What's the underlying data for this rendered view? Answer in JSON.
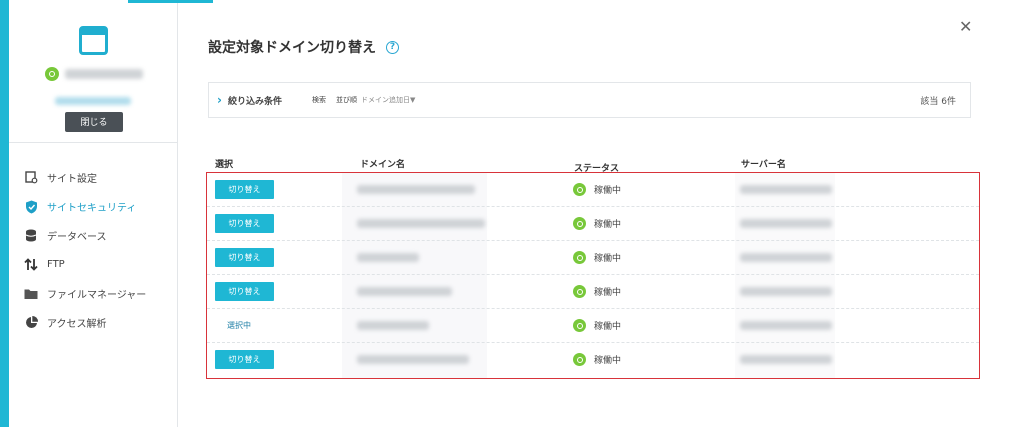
{
  "sidebar": {
    "close_label": "閉じる",
    "items": [
      {
        "label": "サイト設定",
        "icon": "site-settings-icon"
      },
      {
        "label": "サイトセキュリティ",
        "icon": "shield-icon",
        "active": true
      },
      {
        "label": "データベース",
        "icon": "database-icon"
      },
      {
        "label": "FTP",
        "icon": "transfer-arrows-icon"
      },
      {
        "label": "ファイルマネージャー",
        "icon": "folder-icon"
      },
      {
        "label": "アクセス解析",
        "icon": "pie-chart-icon"
      }
    ]
  },
  "main": {
    "title": "設定対象ドメイン切り替え",
    "help": "?",
    "close": "✕",
    "filter": {
      "label": "絞り込み条件",
      "search": "検索",
      "sort_label": "並び順",
      "sort_value": "ドメイン追加日▼",
      "count": "該当 6件"
    },
    "columns": {
      "select": "選択",
      "domain": "ドメイン名",
      "status": "ステータス",
      "server": "サーバー名"
    },
    "switch_label": "切り替え",
    "selected_label": "選択中",
    "status_label": "稼働中",
    "accent": "#1fb7d4",
    "highlight": "#d8333a"
  }
}
